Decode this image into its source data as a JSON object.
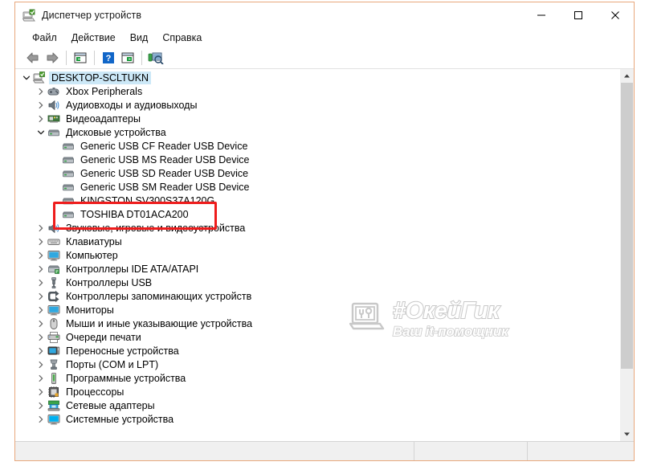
{
  "window": {
    "title": "Диспетчер устройств",
    "title_icon": "device-manager-icon",
    "border_color": "#e8a87c"
  },
  "window_controls": {
    "minimize": "—",
    "maximize": "□",
    "close": "✕"
  },
  "menu": {
    "items": [
      {
        "label": "Файл",
        "name": "menu-file"
      },
      {
        "label": "Действие",
        "name": "menu-action"
      },
      {
        "label": "Вид",
        "name": "menu-view"
      },
      {
        "label": "Справка",
        "name": "menu-help"
      }
    ]
  },
  "toolbar": {
    "buttons": [
      {
        "name": "back-icon",
        "title": "Назад"
      },
      {
        "name": "forward-icon",
        "title": "Вперёд"
      },
      {
        "name": "properties-icon",
        "title": "Свойства"
      },
      {
        "name": "help-icon",
        "title": "Справка"
      },
      {
        "name": "show-hide-console-tree-icon",
        "title": "Показать/скрыть дерево консоли"
      },
      {
        "name": "scan-hardware-changes-icon",
        "title": "Обновить конфигурацию оборудования"
      }
    ]
  },
  "tree": {
    "rows": [
      {
        "label": "DESKTOP-SCLTUKN",
        "icon": "computer-icon",
        "indent": 0,
        "twisty": "expanded",
        "selected": true
      },
      {
        "label": "Xbox Peripherals",
        "icon": "xbox-icon",
        "indent": 1,
        "twisty": "collapsed",
        "selected": false
      },
      {
        "label": "Аудиовходы и аудиовыходы",
        "icon": "audio-icon",
        "indent": 1,
        "twisty": "collapsed",
        "selected": false
      },
      {
        "label": "Видеоадаптеры",
        "icon": "display-adapter-icon",
        "indent": 1,
        "twisty": "collapsed",
        "selected": false
      },
      {
        "label": "Дисковые устройства",
        "icon": "disk-icon",
        "indent": 1,
        "twisty": "expanded",
        "selected": false
      },
      {
        "label": "Generic USB  CF Reader USB Device",
        "icon": "disk-icon",
        "indent": 2,
        "twisty": "none",
        "selected": false
      },
      {
        "label": "Generic USB  MS Reader USB Device",
        "icon": "disk-icon",
        "indent": 2,
        "twisty": "none",
        "selected": false
      },
      {
        "label": "Generic USB  SD Reader USB Device",
        "icon": "disk-icon",
        "indent": 2,
        "twisty": "none",
        "selected": false
      },
      {
        "label": "Generic USB  SM Reader USB Device",
        "icon": "disk-icon",
        "indent": 2,
        "twisty": "none",
        "selected": false
      },
      {
        "label": "KINGSTON SV300S37A120G",
        "icon": "disk-icon",
        "indent": 2,
        "twisty": "none",
        "selected": false
      },
      {
        "label": "TOSHIBA DT01ACA200",
        "icon": "disk-icon",
        "indent": 2,
        "twisty": "none",
        "selected": false
      },
      {
        "label": "Звуковые, игровые и видеоустройства",
        "icon": "audio-icon",
        "indent": 1,
        "twisty": "collapsed",
        "selected": false
      },
      {
        "label": "Клавиатуры",
        "icon": "keyboard-icon",
        "indent": 1,
        "twisty": "collapsed",
        "selected": false
      },
      {
        "label": "Компьютер",
        "icon": "monitor-icon",
        "indent": 1,
        "twisty": "collapsed",
        "selected": false
      },
      {
        "label": "Контроллеры IDE ATA/ATAPI",
        "icon": "ide-controller-icon",
        "indent": 1,
        "twisty": "collapsed",
        "selected": false
      },
      {
        "label": "Контроллеры USB",
        "icon": "usb-icon",
        "indent": 1,
        "twisty": "collapsed",
        "selected": false
      },
      {
        "label": "Контроллеры запоминающих устройств",
        "icon": "storage-controller-icon",
        "indent": 1,
        "twisty": "collapsed",
        "selected": false
      },
      {
        "label": "Мониторы",
        "icon": "monitor-icon",
        "indent": 1,
        "twisty": "collapsed",
        "selected": false
      },
      {
        "label": "Мыши и иные указывающие устройства",
        "icon": "mouse-icon",
        "indent": 1,
        "twisty": "collapsed",
        "selected": false
      },
      {
        "label": "Очереди печати",
        "icon": "printer-icon",
        "indent": 1,
        "twisty": "collapsed",
        "selected": false
      },
      {
        "label": "Переносные устройства",
        "icon": "portable-device-icon",
        "indent": 1,
        "twisty": "collapsed",
        "selected": false
      },
      {
        "label": "Порты (COM и LPT)",
        "icon": "port-icon",
        "indent": 1,
        "twisty": "collapsed",
        "selected": false
      },
      {
        "label": "Программные устройства",
        "icon": "software-device-icon",
        "indent": 1,
        "twisty": "collapsed",
        "selected": false
      },
      {
        "label": "Процессоры",
        "icon": "processor-icon",
        "indent": 1,
        "twisty": "collapsed",
        "selected": false
      },
      {
        "label": "Сетевые адаптеры",
        "icon": "network-adapter-icon",
        "indent": 1,
        "twisty": "collapsed",
        "selected": false
      },
      {
        "label": "Системные устройства",
        "icon": "system-device-icon",
        "indent": 1,
        "twisty": "collapsed",
        "selected": false
      }
    ],
    "selection_color": "#cce8f7"
  },
  "annotation": {
    "color": "#ee1c1c",
    "target_label": "TOSHIBA DT01ACA200"
  },
  "watermark": {
    "line1": "#ОкейГик",
    "line2": "Ваш it-помощник",
    "icon": "laptop-repair-icon"
  },
  "statusbar": {
    "main": "",
    "pane2": "",
    "pane3": ""
  },
  "scrollbar": {
    "up_arrow": "▲",
    "down_arrow": "▼"
  }
}
